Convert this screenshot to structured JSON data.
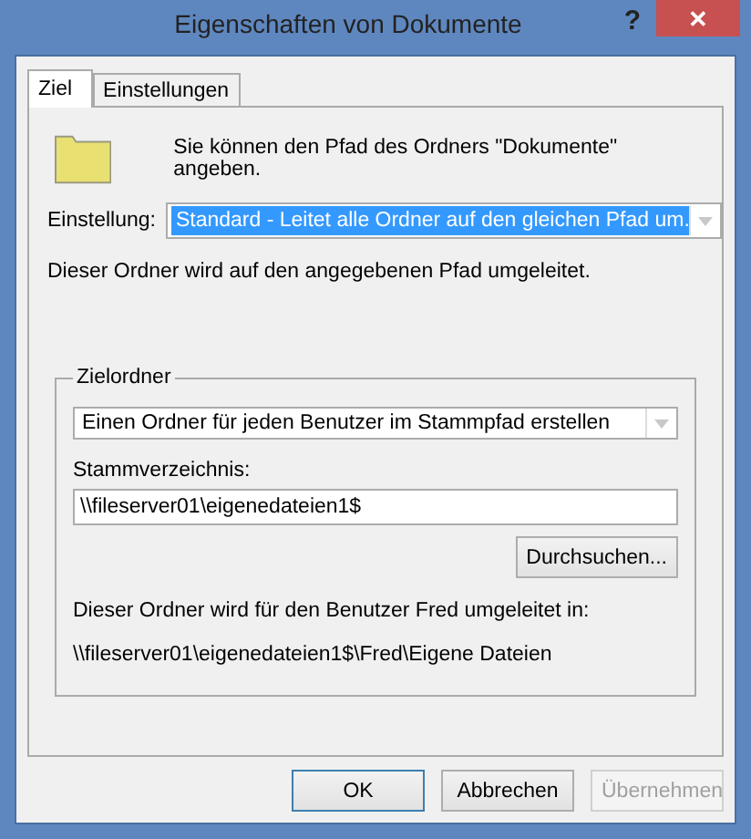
{
  "window": {
    "title": "Eigenschaften von Dokumente",
    "help": "?",
    "close": "✕"
  },
  "tabs": [
    {
      "label": "Ziel",
      "selected": true
    },
    {
      "label": "Einstellungen",
      "selected": false
    }
  ],
  "intro": "Sie können den Pfad des Ordners \"Dokumente\" angeben.",
  "setting": {
    "label": "Einstellung:",
    "value": "Standard - Leitet alle Ordner auf den gleichen Pfad um.",
    "selected": true
  },
  "setting_info": "Dieser Ordner wird auf den angegebenen Pfad umgeleitet.",
  "target_group": {
    "title": "Zielordner",
    "mode": "Einen Ordner für jeden Benutzer im Stammpfad erstellen",
    "root_label": "Stammverzeichnis:",
    "root_value": "\\\\fileserver01\\eigenedateien1$",
    "browse": "Durchsuchen...",
    "result_label": "Dieser Ordner wird für den Benutzer Fred umgeleitet in:",
    "result_path": "\\\\fileserver01\\eigenedateien1$\\Fred\\Eigene Dateien"
  },
  "buttons": [
    {
      "label": "OK",
      "default": true,
      "disabled": false
    },
    {
      "label": "Abbrechen",
      "default": false,
      "disabled": false
    },
    {
      "label": "Übernehmen",
      "default": false,
      "disabled": true
    }
  ]
}
